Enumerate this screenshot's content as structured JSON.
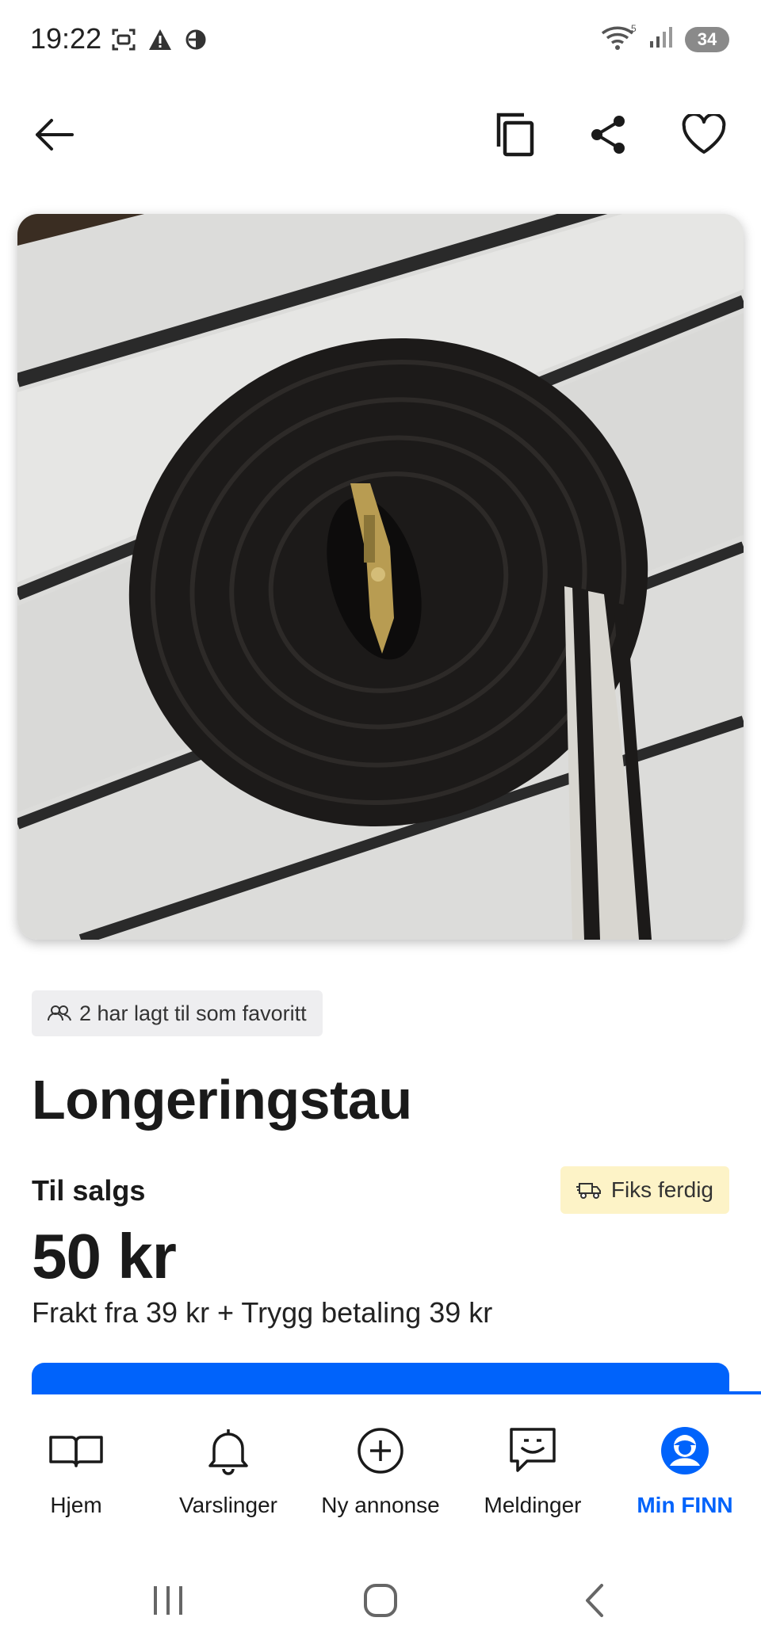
{
  "status_bar": {
    "time": "19:22",
    "battery": "34"
  },
  "toolbar": {
    "back_icon": "arrow-left-icon",
    "copy_icon": "copy-icon",
    "share_icon": "share-icon",
    "favorite_icon": "heart-icon"
  },
  "listing": {
    "favorites_text": "2 har lagt til som favoritt",
    "title": "Longeringstau",
    "status": "Til salgs",
    "delivery_badge": "Fiks ferdig",
    "price": "50 kr",
    "shipping": "Frakt fra 39 kr + Trygg betaling 39 kr"
  },
  "bottom_nav": {
    "items": [
      {
        "label": "Hjem",
        "icon": "book-icon"
      },
      {
        "label": "Varslinger",
        "icon": "bell-icon"
      },
      {
        "label": "Ny annonse",
        "icon": "plus-circle-icon"
      },
      {
        "label": "Meldinger",
        "icon": "chat-icon"
      },
      {
        "label": "Min FINN",
        "icon": "profile-icon",
        "active": true
      }
    ]
  },
  "colors": {
    "accent": "#0063fb",
    "badge_bg": "#eeeef0",
    "delivery_badge_bg": "#fdf3c7"
  }
}
